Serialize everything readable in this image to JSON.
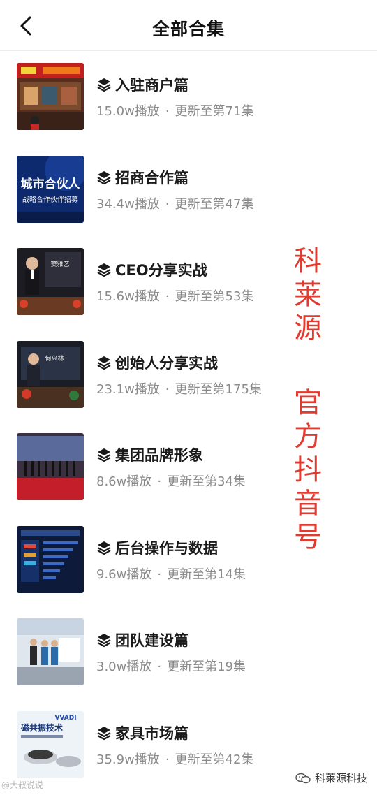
{
  "header": {
    "title": "全部合集"
  },
  "items": [
    {
      "title": "入驻商户篇",
      "plays": "15.0w播放",
      "dot": "·",
      "update": "更新至第71集",
      "thumb": "storefront-thumbnail"
    },
    {
      "title": "招商合作篇",
      "plays": "34.4w播放",
      "dot": "·",
      "update": "更新至第47集",
      "thumb": "city-partner-thumbnail",
      "thumb_text_1": "城市合伙人",
      "thumb_text_2": "战略合作伙伴招募"
    },
    {
      "title": "CEO分享实战",
      "plays": "15.6w播放",
      "dot": "·",
      "update": "更新至第53集",
      "thumb": "ceo-speech-thumbnail",
      "thumb_text_1": "窦雅艺"
    },
    {
      "title": "创始人分享实战",
      "plays": "23.1w播放",
      "dot": "·",
      "update": "更新至第175集",
      "thumb": "founder-speech-thumbnail",
      "thumb_text_1": "何兴林"
    },
    {
      "title": "集团品牌形象",
      "plays": "8.6w播放",
      "dot": "·",
      "update": "更新至第34集",
      "thumb": "group-photo-thumbnail"
    },
    {
      "title": "后台操作与数据",
      "plays": "9.6w播放",
      "dot": "·",
      "update": "更新至第14集",
      "thumb": "dashboard-thumbnail"
    },
    {
      "title": "团队建设篇",
      "plays": "3.0w播放",
      "dot": "·",
      "update": "更新至第19集",
      "thumb": "team-expo-thumbnail"
    },
    {
      "title": "家具市场篇",
      "plays": "35.9w播放",
      "dot": "·",
      "update": "更新至第42集",
      "thumb": "maglev-tech-thumbnail",
      "thumb_text_1": "磁共振技术",
      "thumb_text_2": "VVADI"
    }
  ],
  "overlay": {
    "line1": [
      "科",
      "莱",
      "源"
    ],
    "line2": [
      "官",
      "方",
      "抖",
      "音",
      "号"
    ]
  },
  "watermarks": {
    "left": "@大叔说说",
    "right": "科莱源科技"
  },
  "colors": {
    "overlay_red": "#e23a2e",
    "meta_gray": "#8a8a8a"
  }
}
